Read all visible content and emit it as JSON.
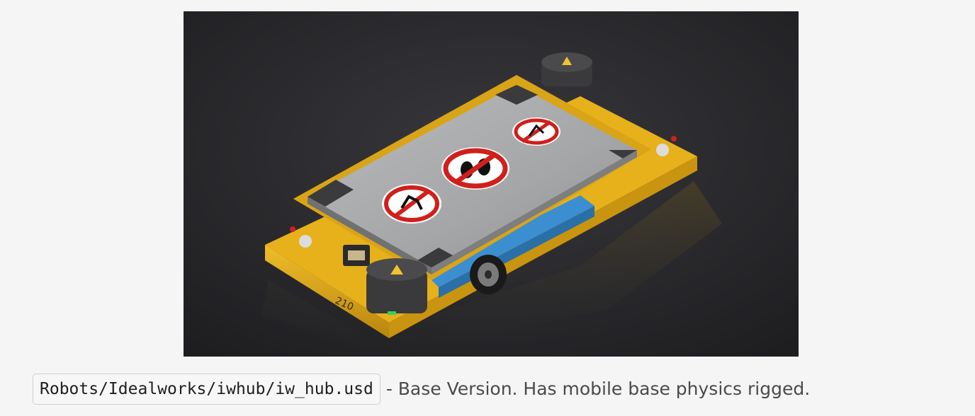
{
  "figure": {
    "robot_number": "210",
    "colors": {
      "background": "#2a2a2d",
      "chassis_yellow": "#e7b11c",
      "deck_gray": "#a9abad",
      "sign_red": "#d0201c",
      "blue_motor": "#3b8fd0"
    },
    "signs": [
      "no-climbing-sign-icon",
      "no-stepping-sign-icon",
      "no-slipping-sign-icon",
      "warning-triangle-icon"
    ]
  },
  "caption": {
    "path": "Robots/Idealworks/iwhub/iw_hub.usd",
    "description": "- Base Version. Has mobile base physics rigged."
  }
}
